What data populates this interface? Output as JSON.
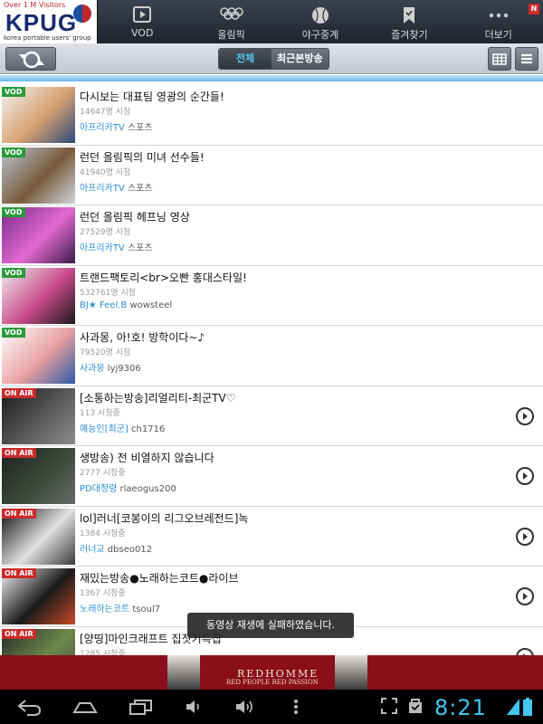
{
  "logo": {
    "visitors": "Over 1 M Visitors",
    "brand": "KPUG",
    "sub": "korea portable users' group"
  },
  "nav": [
    {
      "label": "VOD",
      "icon": "vod-icon"
    },
    {
      "label": "올림픽",
      "icon": "olympic-rings-icon"
    },
    {
      "label": "야구중계",
      "icon": "baseball-icon"
    },
    {
      "label": "즐겨찾기",
      "icon": "bookmark-icon"
    },
    {
      "label": "더보기",
      "icon": "more-icon",
      "badge": "N"
    }
  ],
  "toolbar": {
    "all_label": "전체",
    "recent_label": "최근본방송"
  },
  "rows": [
    {
      "tag": "VOD",
      "title": "다시보는 대표팀 영광의 순간들!",
      "views": "14647명 시청",
      "channel": "아프리카TV",
      "user": "스포츠",
      "arrow": false
    },
    {
      "tag": "VOD",
      "title": "런던 올림픽의 미녀 선수들!",
      "views": "41940명 시청",
      "channel": "아프리카TV",
      "user": "스포츠",
      "arrow": false
    },
    {
      "tag": "VOD",
      "title": "런던 올림픽 헤프닝 영상",
      "views": "27529명 시청",
      "channel": "아프리카TV",
      "user": "스포츠",
      "arrow": false
    },
    {
      "tag": "VOD",
      "title": "트랜드팩토리<br>오빤 홍대스타일!",
      "views": "532761명 시청",
      "channel": "BJ★ Feel.B",
      "user": "wowsteel",
      "arrow": false
    },
    {
      "tag": "VOD",
      "title": "사과몽, 아!호! 방학이다~♪",
      "views": "79520명 시청",
      "channel": "사과몽",
      "user": "lyj9306",
      "arrow": false
    },
    {
      "tag": "ON AIR",
      "title": "[소통하는방송]리얼리티-최군TV♡",
      "views": "113 시청중",
      "channel": "예능인[최군]",
      "user": "ch1716",
      "arrow": true
    },
    {
      "tag": "ON AIR",
      "title": "생방송) 전 비열하지 않습니다",
      "views": "2777 시청중",
      "channel": "PD대정령",
      "user": "rlaeogus200",
      "arrow": true
    },
    {
      "tag": "ON AIR",
      "title": "lol]러너[코봉이의 리그오브레전드]녹",
      "views": "1384 시청중",
      "channel": "러너교",
      "user": "dbseo012",
      "arrow": true
    },
    {
      "tag": "ON AIR",
      "title": "재밌는방송●노래하는코트●라이브",
      "views": "1367 시청중",
      "channel": "노래하는코트",
      "user": "tsoul7",
      "arrow": true
    },
    {
      "tag": "ON AIR",
      "title": "[양띵]마인크래프트 집짓기특집",
      "views": "1285 시청중",
      "channel": "",
      "user": "",
      "arrow": true
    }
  ],
  "toast": "동영상 재생에 실패하였습니다.",
  "ad": {
    "brand": "REDHOMME",
    "tagline": "RED PEOPLE RED PASSION"
  },
  "status": {
    "time": "8:21"
  },
  "colors": {
    "vod_tag": "#2a9a3a",
    "onair_tag": "#c92a2a",
    "channel": "#2d8fd3",
    "clock": "#42c5ef"
  }
}
